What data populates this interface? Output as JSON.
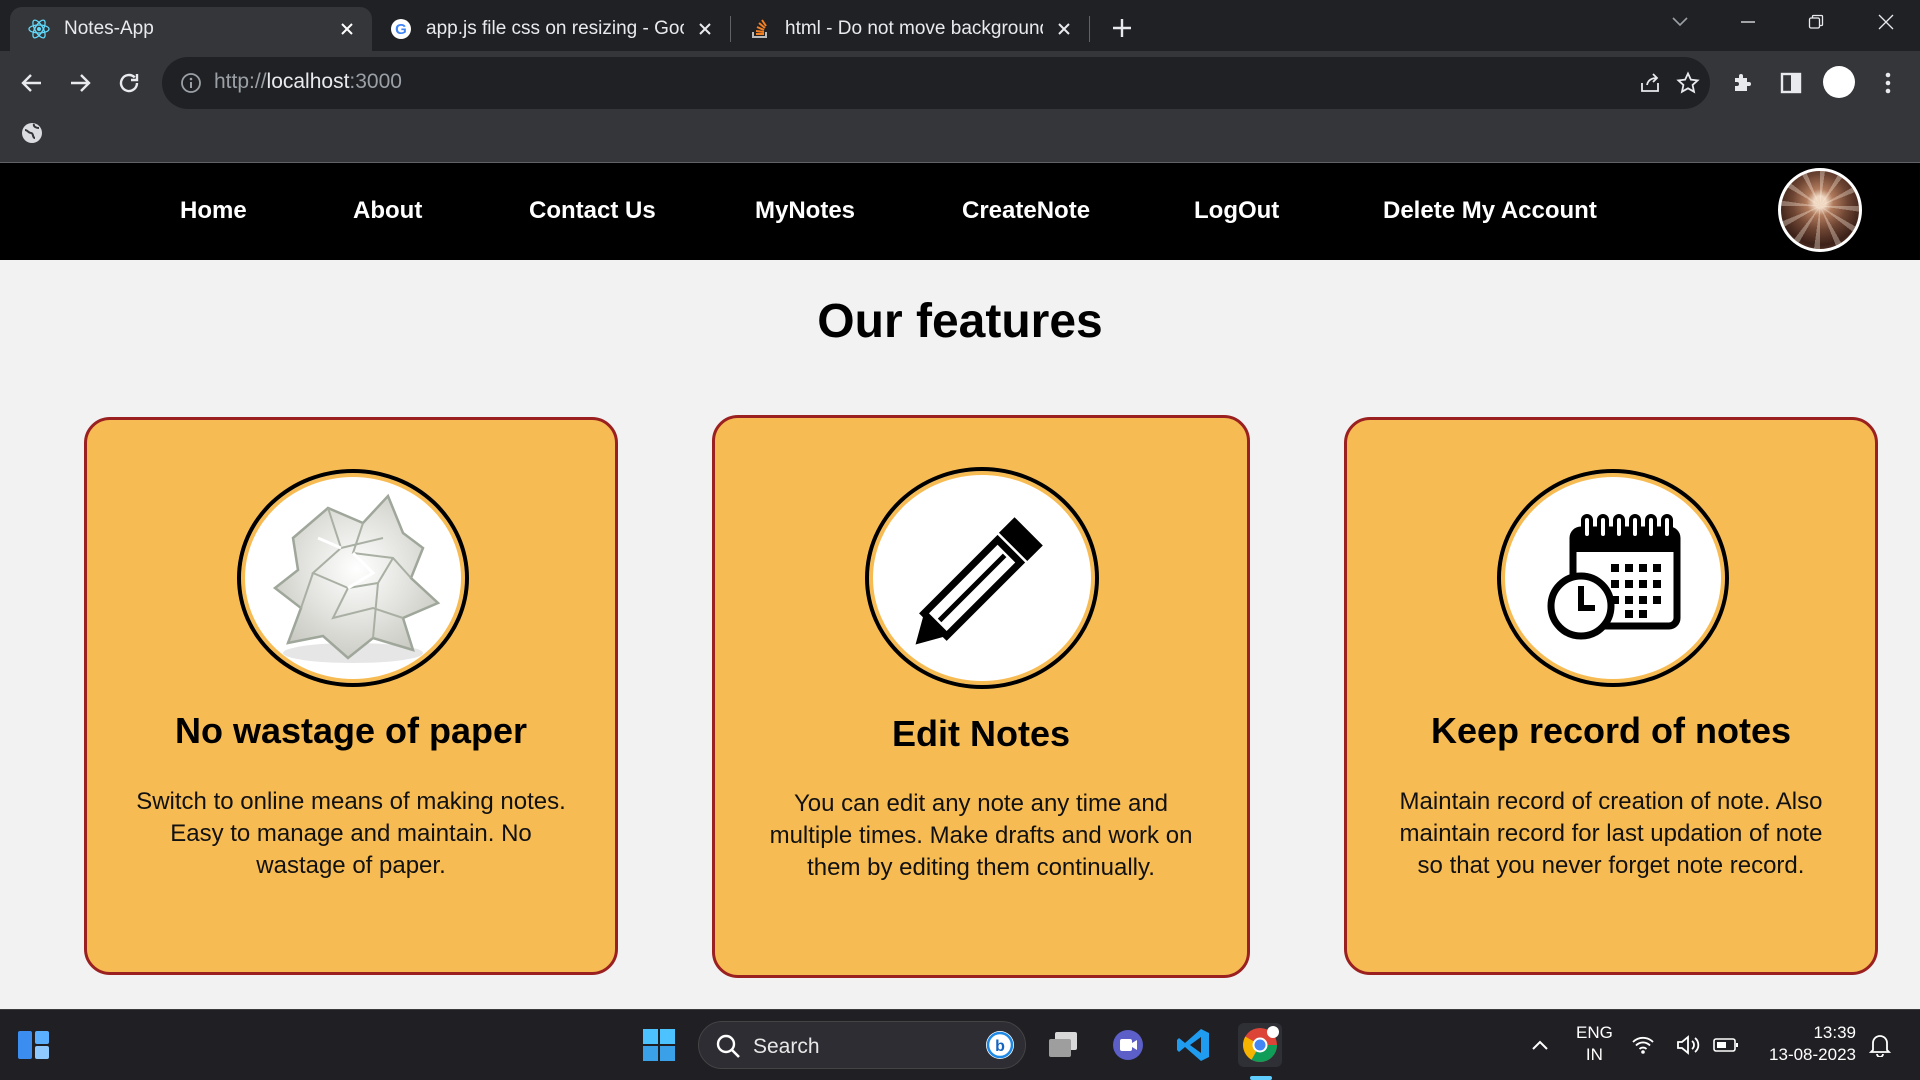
{
  "browser": {
    "tabs": [
      {
        "title": "Notes-App",
        "icon": "react-icon",
        "active": true
      },
      {
        "title": "app.js file css on resizing - Googl",
        "icon": "google-icon",
        "active": false
      },
      {
        "title": "html - Do not move background",
        "icon": "stackoverflow-icon",
        "active": false
      }
    ],
    "url_scheme": "http://",
    "url_host": "localhost",
    "url_rest": ":3000"
  },
  "navbar": {
    "links": [
      "Home",
      "About",
      "Contact Us",
      "MyNotes",
      "CreateNote",
      "LogOut",
      "Delete My Account"
    ],
    "avatar": "profile-avatar"
  },
  "main": {
    "heading": "Our features",
    "cards": [
      {
        "icon": "crumpled-paper-icon",
        "title": "No wastage of paper",
        "desc_lines": [
          "Switch to online means of making notes.",
          "Easy to manage and maintain. No",
          "wastage of paper."
        ]
      },
      {
        "icon": "pencil-icon",
        "title": "Edit Notes",
        "desc_lines": [
          "You can edit any note any time and",
          "multiple times. Make drafts and work on",
          "them by editing them continually."
        ]
      },
      {
        "icon": "calendar-clock-icon",
        "title": "Keep record of notes",
        "desc_lines": [
          "Maintain record of creation of note. Also",
          "maintain record for last updation of note",
          "so that you never forget note record."
        ]
      }
    ],
    "colors": {
      "card_bg": "#f7bb54",
      "card_border": "#9b2121",
      "navbar_bg": "#000000"
    }
  },
  "taskbar": {
    "search_label": "Search",
    "lang_line1": "ENG",
    "lang_line2": "IN",
    "time": "13:39",
    "date": "13-08-2023"
  }
}
